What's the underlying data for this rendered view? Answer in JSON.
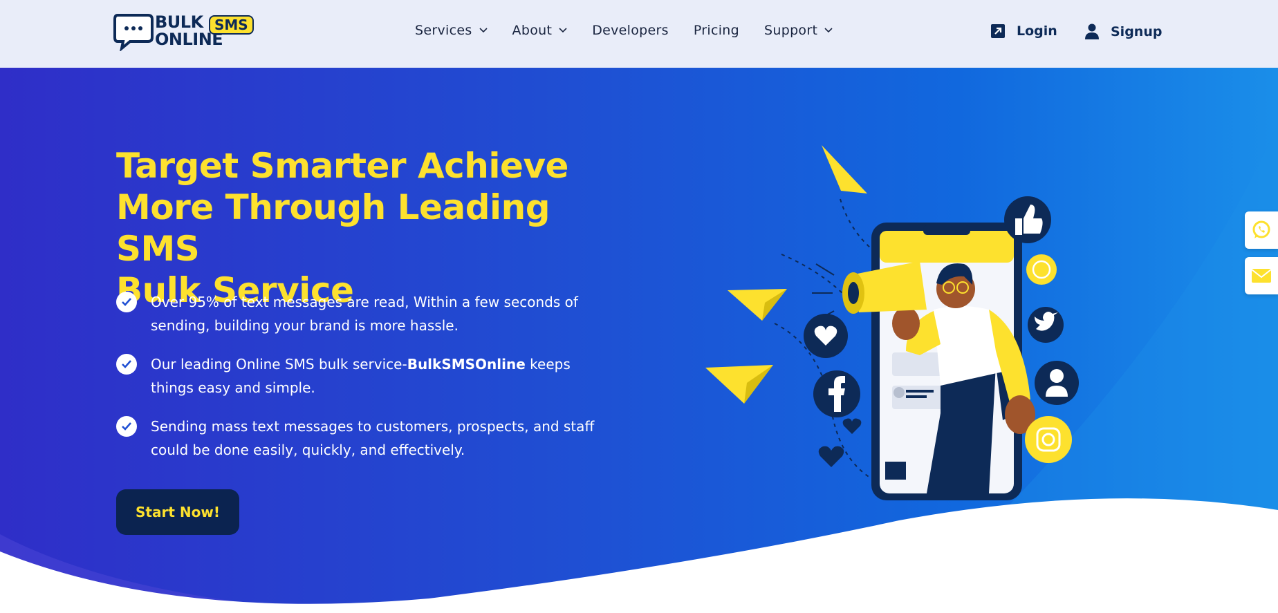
{
  "brand": {
    "logo_line1": "BULK",
    "logo_sms": "SMS",
    "logo_line2": "ONLINE",
    "accent_yellow": "#fde12e",
    "navy": "#0b2350",
    "hero_blue": "#1f4fd3"
  },
  "nav": {
    "items": [
      {
        "label": "Services",
        "dropdown": true
      },
      {
        "label": "About",
        "dropdown": true
      },
      {
        "label": "Developers",
        "dropdown": false
      },
      {
        "label": "Pricing",
        "dropdown": false
      },
      {
        "label": "Support",
        "dropdown": true
      }
    ],
    "login_label": "Login",
    "signup_label": "Signup"
  },
  "hero": {
    "headline_line1": "Target Smarter Achieve",
    "headline_line2": "More Through Leading SMS",
    "headline_line3": "Bulk Service",
    "bullets": [
      {
        "text": "Over 95% of text messages are read, Within a few seconds of sending, building your brand is more hassle."
      },
      {
        "pre": "Our leading Online SMS bulk service-",
        "bold": "BulkSMSOnline",
        "post": " keeps things easy and simple."
      },
      {
        "text": "Sending mass text messages to customers, prospects, and staff could be done easily, quickly, and effectively."
      }
    ],
    "cta_label": "Start Now!"
  },
  "side_tabs": {
    "icons": [
      "whatsapp-icon",
      "mail-icon"
    ]
  }
}
